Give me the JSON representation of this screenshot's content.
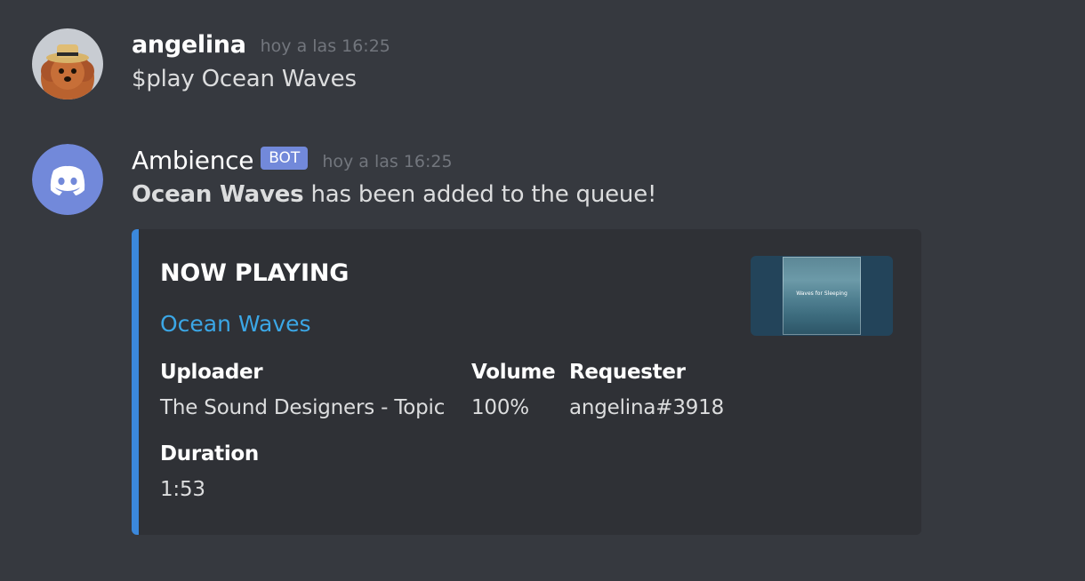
{
  "messages": [
    {
      "author": "angelina",
      "timestamp": "hoy a las 16:25",
      "content": "$play Ocean Waves",
      "avatar_icon": "dog-with-hat-avatar"
    },
    {
      "author": "Ambience",
      "bot_tag": "BOT",
      "timestamp": "hoy a las 16:25",
      "content_bold": "Ocean Waves",
      "content_rest": " has been added to the queue!",
      "avatar_icon": "discord-logo-icon",
      "avatar_color": "#7289da",
      "embed": {
        "accent_color": "#3b88dc",
        "title": "NOW PLAYING",
        "link": "Ocean Waves",
        "thumbnail_text": "Waves for Sleeping",
        "fields": {
          "uploader": {
            "name": "Uploader",
            "value": "The Sound Designers - Topic"
          },
          "volume": {
            "name": "Volume",
            "value": "100%"
          },
          "requester": {
            "name": "Requester",
            "value": "angelina#3918"
          },
          "duration": {
            "name": "Duration",
            "value": "1:53"
          }
        }
      }
    }
  ]
}
